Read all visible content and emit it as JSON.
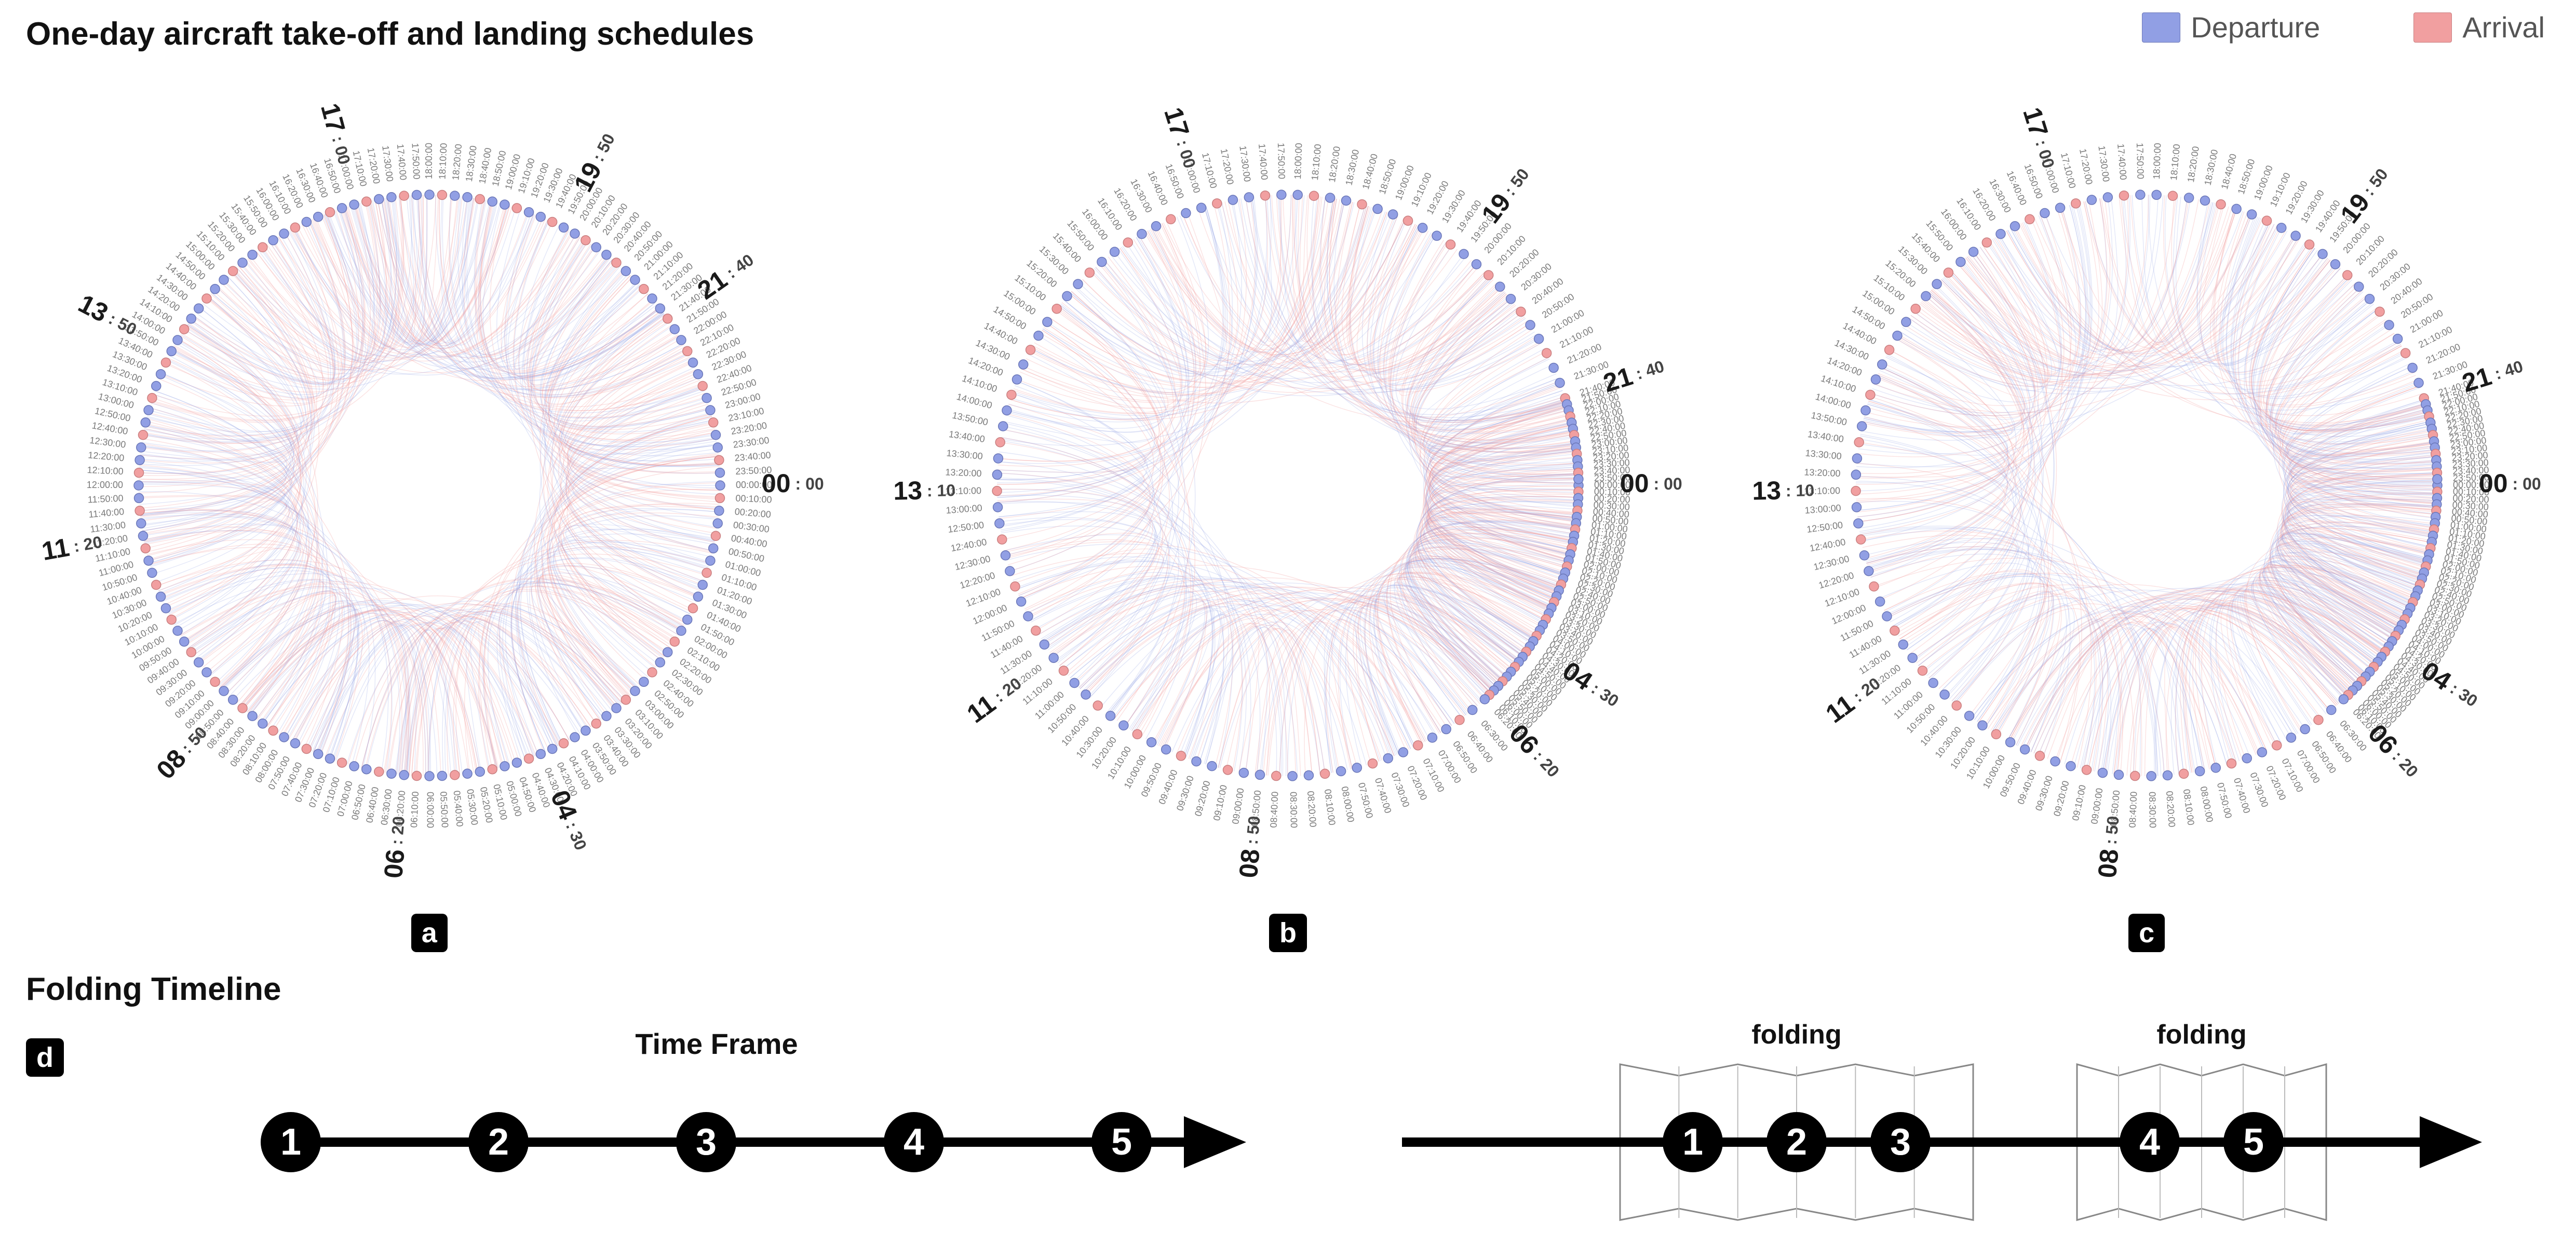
{
  "title": "One-day aircraft take-off and landing schedules",
  "folding_title": "Folding Timeline",
  "legend": {
    "departure": {
      "label": "Departure",
      "color": "#919fe4",
      "stroke": "#6b77b8"
    },
    "arrival": {
      "label": "Arrival",
      "color": "#f19fa0",
      "stroke": "#c97f80"
    }
  },
  "panels": {
    "a": {
      "label": "a"
    },
    "b": {
      "label": "b"
    },
    "c": {
      "label": "c"
    },
    "d": {
      "label": "d"
    }
  },
  "radial_big_ticks": [
    {
      "hh": "00",
      "mm": "00"
    },
    {
      "hh": "04",
      "mm": "30"
    },
    {
      "hh": "06",
      "mm": "20"
    },
    {
      "hh": "08",
      "mm": "50"
    },
    {
      "hh": "11",
      "mm": "20"
    },
    {
      "hh": "13",
      "mm": "50"
    },
    {
      "hh": "17",
      "mm": "00"
    },
    {
      "hh": "19",
      "mm": "50"
    },
    {
      "hh": "21",
      "mm": "40"
    }
  ],
  "radial_bc_big_ticks": [
    {
      "hh": "00",
      "mm": "00"
    },
    {
      "hh": "04",
      "mm": "30"
    },
    {
      "hh": "06",
      "mm": "20"
    },
    {
      "hh": "08",
      "mm": "50"
    },
    {
      "hh": "11",
      "mm": "20"
    },
    {
      "hh": "13",
      "mm": "10"
    },
    {
      "hh": "17",
      "mm": "00"
    },
    {
      "hh": "19",
      "mm": "50"
    },
    {
      "hh": "21",
      "mm": "40"
    }
  ],
  "radial_a_small_ticks": "every 10 minutes over 24h, 144 ticks labelled HH:MM:00",
  "radial_bc_small_ticks_sparse_right": [
    "23:50:00",
    "23:20:00",
    "22:10:00",
    "21:30:00",
    "21:20:00",
    "21:10:00",
    "21:00:00",
    "20:50:00",
    "20:40:00",
    "20:30:00",
    "20:20:00",
    "20:10:00",
    "20:00:00",
    "04:20:00",
    "05:00:00",
    "06:10:00",
    "07:00:00",
    "07:10:00",
    "07:20:00",
    "07:30:00",
    "07:40:00",
    "07:50:00",
    "08:00:00",
    "08:10:00",
    "08:20:00",
    "08:30:00",
    "08:40:00"
  ],
  "timeline_left": {
    "caption": "Time Frame",
    "nodes": [
      "1",
      "2",
      "3",
      "4",
      "5"
    ]
  },
  "timeline_right": {
    "nodes": [
      "1",
      "2",
      "3",
      "4",
      "5"
    ],
    "fold_labels": [
      "folding",
      "folding"
    ],
    "fold_groups": [
      [
        1,
        2,
        3
      ],
      [
        4,
        5
      ]
    ]
  },
  "chart_data": {
    "type": "chord/radial-timeline",
    "description": "Three circular 24-hour timelines showing departure (blue) and arrival (red) flight links. Panel a is a uniform 24h ring; panels b and c use a folding timeline that compresses low-activity night hours (≈22:00–06:00) and expands peak daytime hours. Individual flight links are too dense to enumerate.",
    "panels": [
      "a",
      "b",
      "c"
    ],
    "colors": {
      "departure": "#919fe4",
      "arrival": "#f19fa0"
    },
    "time_range_hours": [
      0,
      24
    ],
    "tick_interval_minutes": 10,
    "major_ticks_hhmm": [
      "00:00",
      "04:30",
      "06:20",
      "08:50",
      "11:20",
      "13:50",
      "17:00",
      "19:50",
      "21:40"
    ],
    "panel_bc_folded_region_hours_approx": [
      [
        22,
        24
      ],
      [
        0,
        6.33
      ]
    ],
    "panel_d": {
      "type": "schematic",
      "left": "linear timeline with 5 evenly spaced event nodes labelled 1..5 and caption 'Time Frame'",
      "right": "same 5 nodes with two accordion-fold segments covering nodes 1-3 and 4-5, each annotated 'folding'"
    }
  }
}
